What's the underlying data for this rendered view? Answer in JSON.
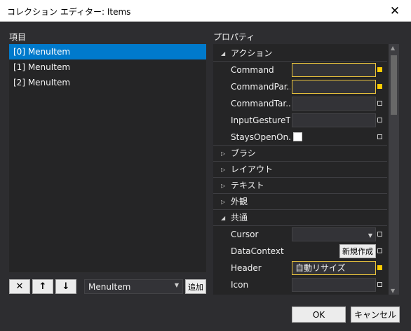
{
  "window": {
    "title": "コレクション エディター: Items",
    "close_glyph": "✕"
  },
  "items_panel": {
    "label": "項目",
    "items": [
      {
        "label": "[0] MenuItem",
        "selected": true
      },
      {
        "label": "[1] MenuItem",
        "selected": false
      },
      {
        "label": "[2] MenuItem",
        "selected": false
      }
    ],
    "tools": {
      "delete_glyph": "✕",
      "up_glyph": "↑",
      "down_glyph": "↓",
      "type_combo_value": "MenuItem",
      "add_label": "追加"
    }
  },
  "properties_panel": {
    "label": "プロパティ",
    "categories": {
      "action": "アクション",
      "brush": "ブラシ",
      "layout": "レイアウト",
      "text": "テキスト",
      "appearance": "外観",
      "common": "共通"
    },
    "action_props": [
      {
        "name": "Command",
        "value": ""
      },
      {
        "name": "CommandPar...",
        "value": ""
      },
      {
        "name": "CommandTar...",
        "value": ""
      },
      {
        "name": "InputGestureT...",
        "value": ""
      },
      {
        "name": "StaysOpenOn..."
      }
    ],
    "common_props": [
      {
        "name": "Cursor",
        "value": ""
      },
      {
        "name": "DataContext",
        "button": "新規作成"
      },
      {
        "name": "Header",
        "value": "自動リサイズ"
      },
      {
        "name": "Icon",
        "value": ""
      }
    ]
  },
  "footer": {
    "ok_label": "OK",
    "cancel_label": "キャンセル"
  },
  "colors": {
    "background": "#2d2d30",
    "panel": "#252526",
    "selection": "#007acc",
    "highlight_border": "#e8c23c",
    "set_marker": "#ffcc00"
  }
}
